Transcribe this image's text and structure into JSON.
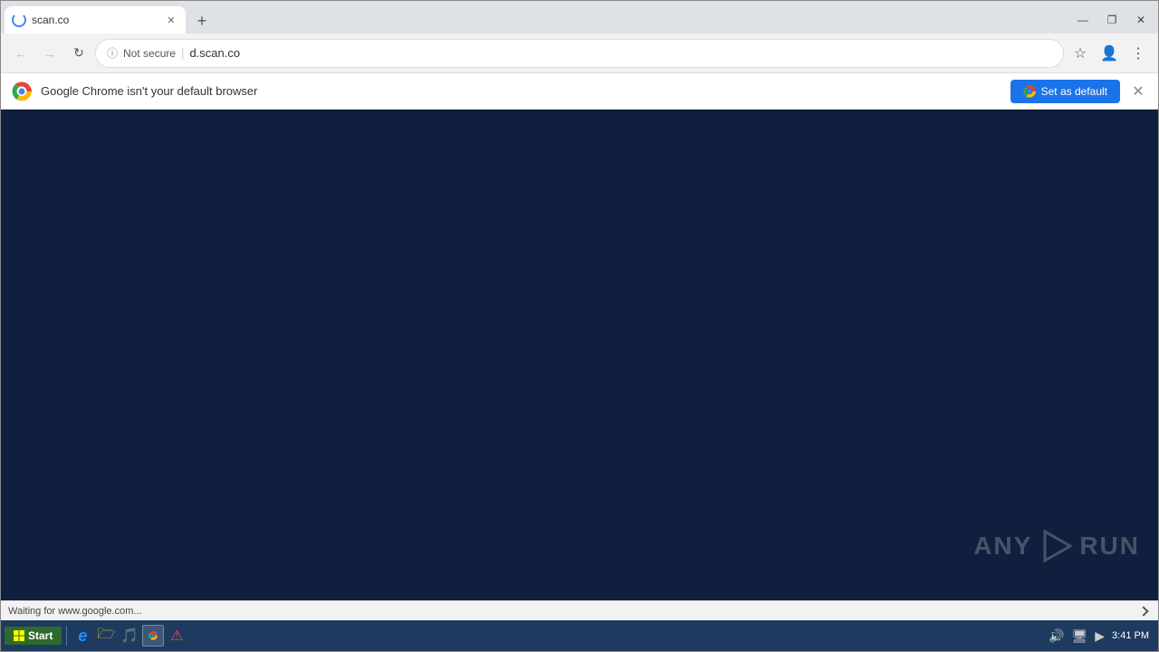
{
  "window": {
    "title": "scan.co",
    "controls": {
      "minimize": "—",
      "maximize": "❐",
      "close": "✕"
    }
  },
  "tab": {
    "title": "scan.co",
    "close_label": "✕"
  },
  "new_tab_btn": "+",
  "toolbar": {
    "back_disabled": true,
    "forward_disabled": true,
    "reload_label": "↻",
    "back_label": "←",
    "forward_label": "→",
    "security_label": "ⓘ",
    "not_secure": "Not secure",
    "divider": "|",
    "url": "d.scan.co",
    "star_label": "☆",
    "profile_label": "👤",
    "menu_label": "⋮"
  },
  "info_bar": {
    "message": "Google Chrome isn't your default browser",
    "set_default_label": "Set as default",
    "close_label": "✕"
  },
  "main": {
    "bg_color": "#0f1f3d"
  },
  "watermark": {
    "text_any": "ANY",
    "text_run": "RUN"
  },
  "status_bar": {
    "text": "Waiting for www.google.com..."
  },
  "taskbar": {
    "start_label": "Start",
    "clock": "3:41 PM",
    "icons": [
      {
        "name": "ie-icon",
        "glyph": "e"
      },
      {
        "name": "folder-icon",
        "glyph": "🗁"
      },
      {
        "name": "media-icon",
        "glyph": "🎵"
      },
      {
        "name": "chrome-icon",
        "glyph": "⊕"
      },
      {
        "name": "warning-icon",
        "glyph": "⚠"
      }
    ]
  }
}
